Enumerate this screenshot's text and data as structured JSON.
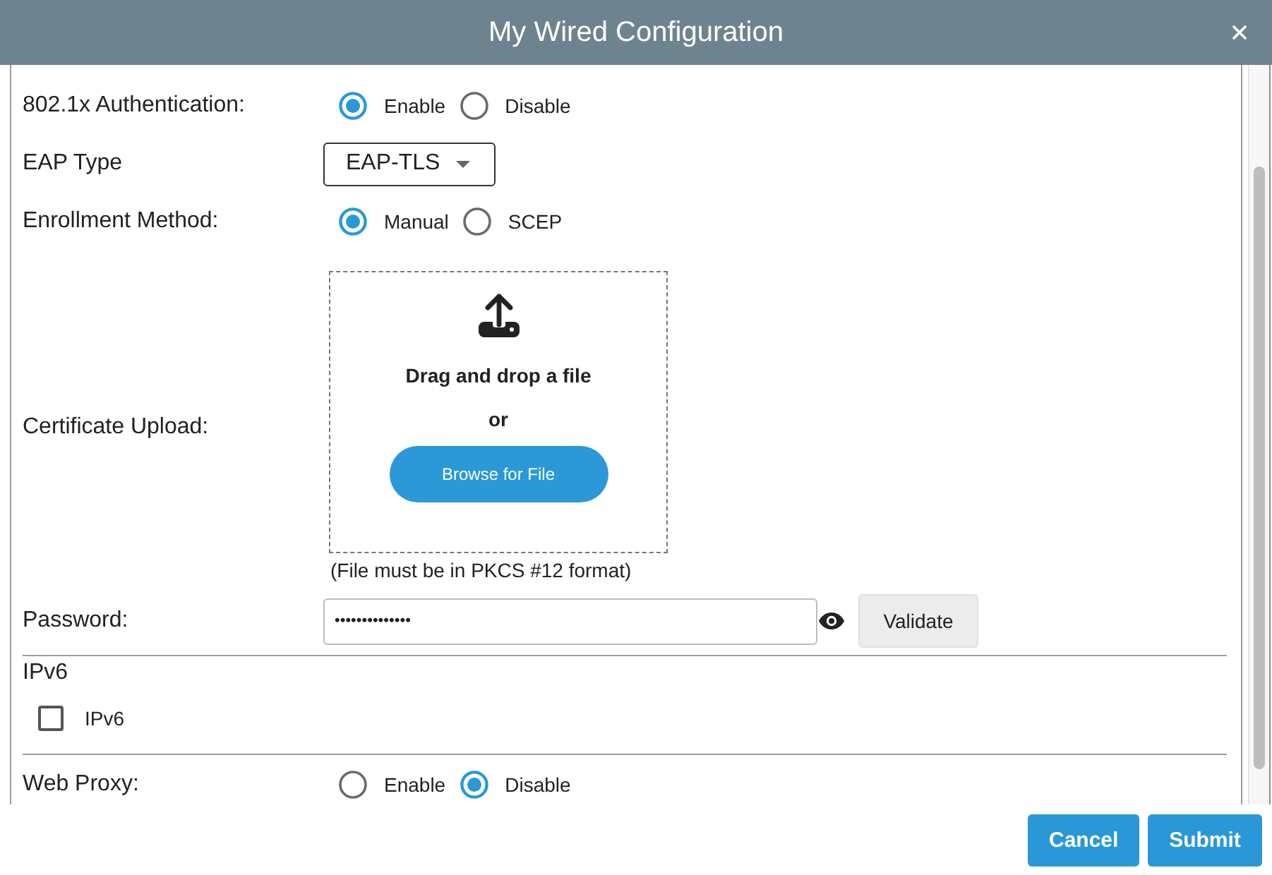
{
  "window": {
    "title": "My Wired Configuration"
  },
  "rows": [
    {
      "kind": "radio",
      "label": "802.1x Authentication:",
      "options": [
        {
          "label": "Enable",
          "selected": true
        },
        {
          "label": "Disable",
          "selected": false
        }
      ]
    },
    {
      "kind": "select",
      "label": "EAP Type",
      "value": "EAP-TLS"
    },
    {
      "kind": "radio",
      "label": "Enrollment Method:",
      "options": [
        {
          "label": "Manual",
          "selected": true
        },
        {
          "label": "SCEP",
          "selected": false
        }
      ]
    },
    {
      "kind": "upload",
      "label": "Certificate Upload:",
      "drop_text": "Drag and drop a file",
      "or_text": "or",
      "button": "Browse for File",
      "note": "(File must be in PKCS #12 format)"
    },
    {
      "kind": "password",
      "label": "Password:",
      "value": "••••••••••••••",
      "button": "Validate"
    },
    {
      "kind": "checkbox_section",
      "heading": "IPv6",
      "label": "IPv6",
      "checked": false
    },
    {
      "kind": "radio",
      "label": "Web Proxy:",
      "options": [
        {
          "label": "Enable",
          "selected": false
        },
        {
          "label": "Disable",
          "selected": true
        }
      ]
    }
  ],
  "footer": {
    "buttons": [
      "Cancel",
      "Submit"
    ]
  }
}
